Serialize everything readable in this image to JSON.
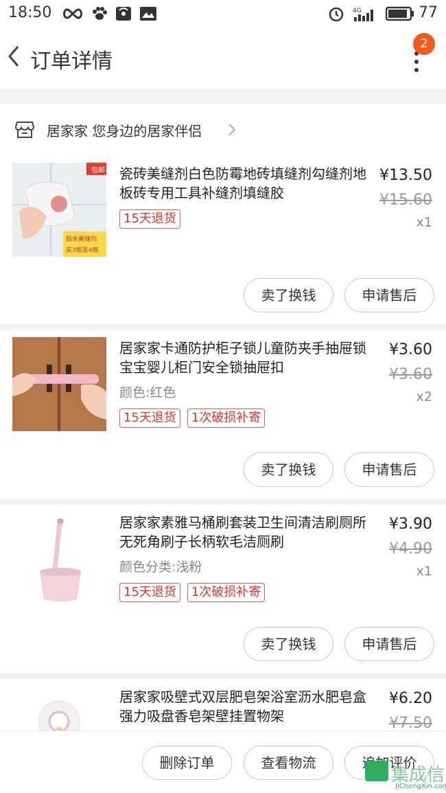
{
  "status_bar": {
    "time": "18:50",
    "battery": "77"
  },
  "nav": {
    "title": "订单详情",
    "badge": "2"
  },
  "store": {
    "name": "居家家 您身边的居家伴侣"
  },
  "items": [
    {
      "title": "瓷砖美缝剂白色防霉地砖填缝剂勾缝剂地板砖专用工具补缝剂填缝胶",
      "price": "¥13.50",
      "original_price": "¥15.60",
      "qty": "x1",
      "spec": "",
      "tags": [
        "15天退货"
      ],
      "thumb_badge": "包邮",
      "thumb_caption_1": "防水美缝剂",
      "thumb_caption_2": "买3瓶发4瓶",
      "btn_sell": "卖了换钱",
      "btn_after": "申请售后"
    },
    {
      "title": "居家家卡通防护柜子锁儿童防夹手抽屉锁宝宝婴儿柜门安全锁抽屉扣",
      "price": "¥3.60",
      "original_price": "¥3.60",
      "qty": "x2",
      "spec": "颜色:红色",
      "tags": [
        "15天退货",
        "1次破损补寄"
      ],
      "btn_sell": "卖了换钱",
      "btn_after": "申请售后"
    },
    {
      "title": "居家家素雅马桶刷套装卫生间清洁刷厕所无死角刷子长柄软毛洁厕刷",
      "price": "¥3.90",
      "original_price": "¥4.90",
      "qty": "x1",
      "spec": "颜色分类:浅粉",
      "tags": [
        "15天退货",
        "1次破损补寄"
      ],
      "btn_sell": "卖了换钱",
      "btn_after": "申请售后"
    },
    {
      "title": "居家家吸壁式双层肥皂架浴室沥水肥皂盒强力吸盘香皂架壁挂置物架",
      "price": "¥6.20",
      "original_price": "¥7.50",
      "qty": "",
      "spec": "",
      "tags": []
    }
  ],
  "bottom_bar": {
    "delete_order": "删除订单",
    "view_logistics": "查看物流",
    "add_review": "追加评价"
  },
  "watermark": {
    "text": "集成信",
    "url": "JiChengXin.com"
  },
  "colors": {
    "accent": "#f25a1e",
    "tag_red": "#e0362a"
  }
}
